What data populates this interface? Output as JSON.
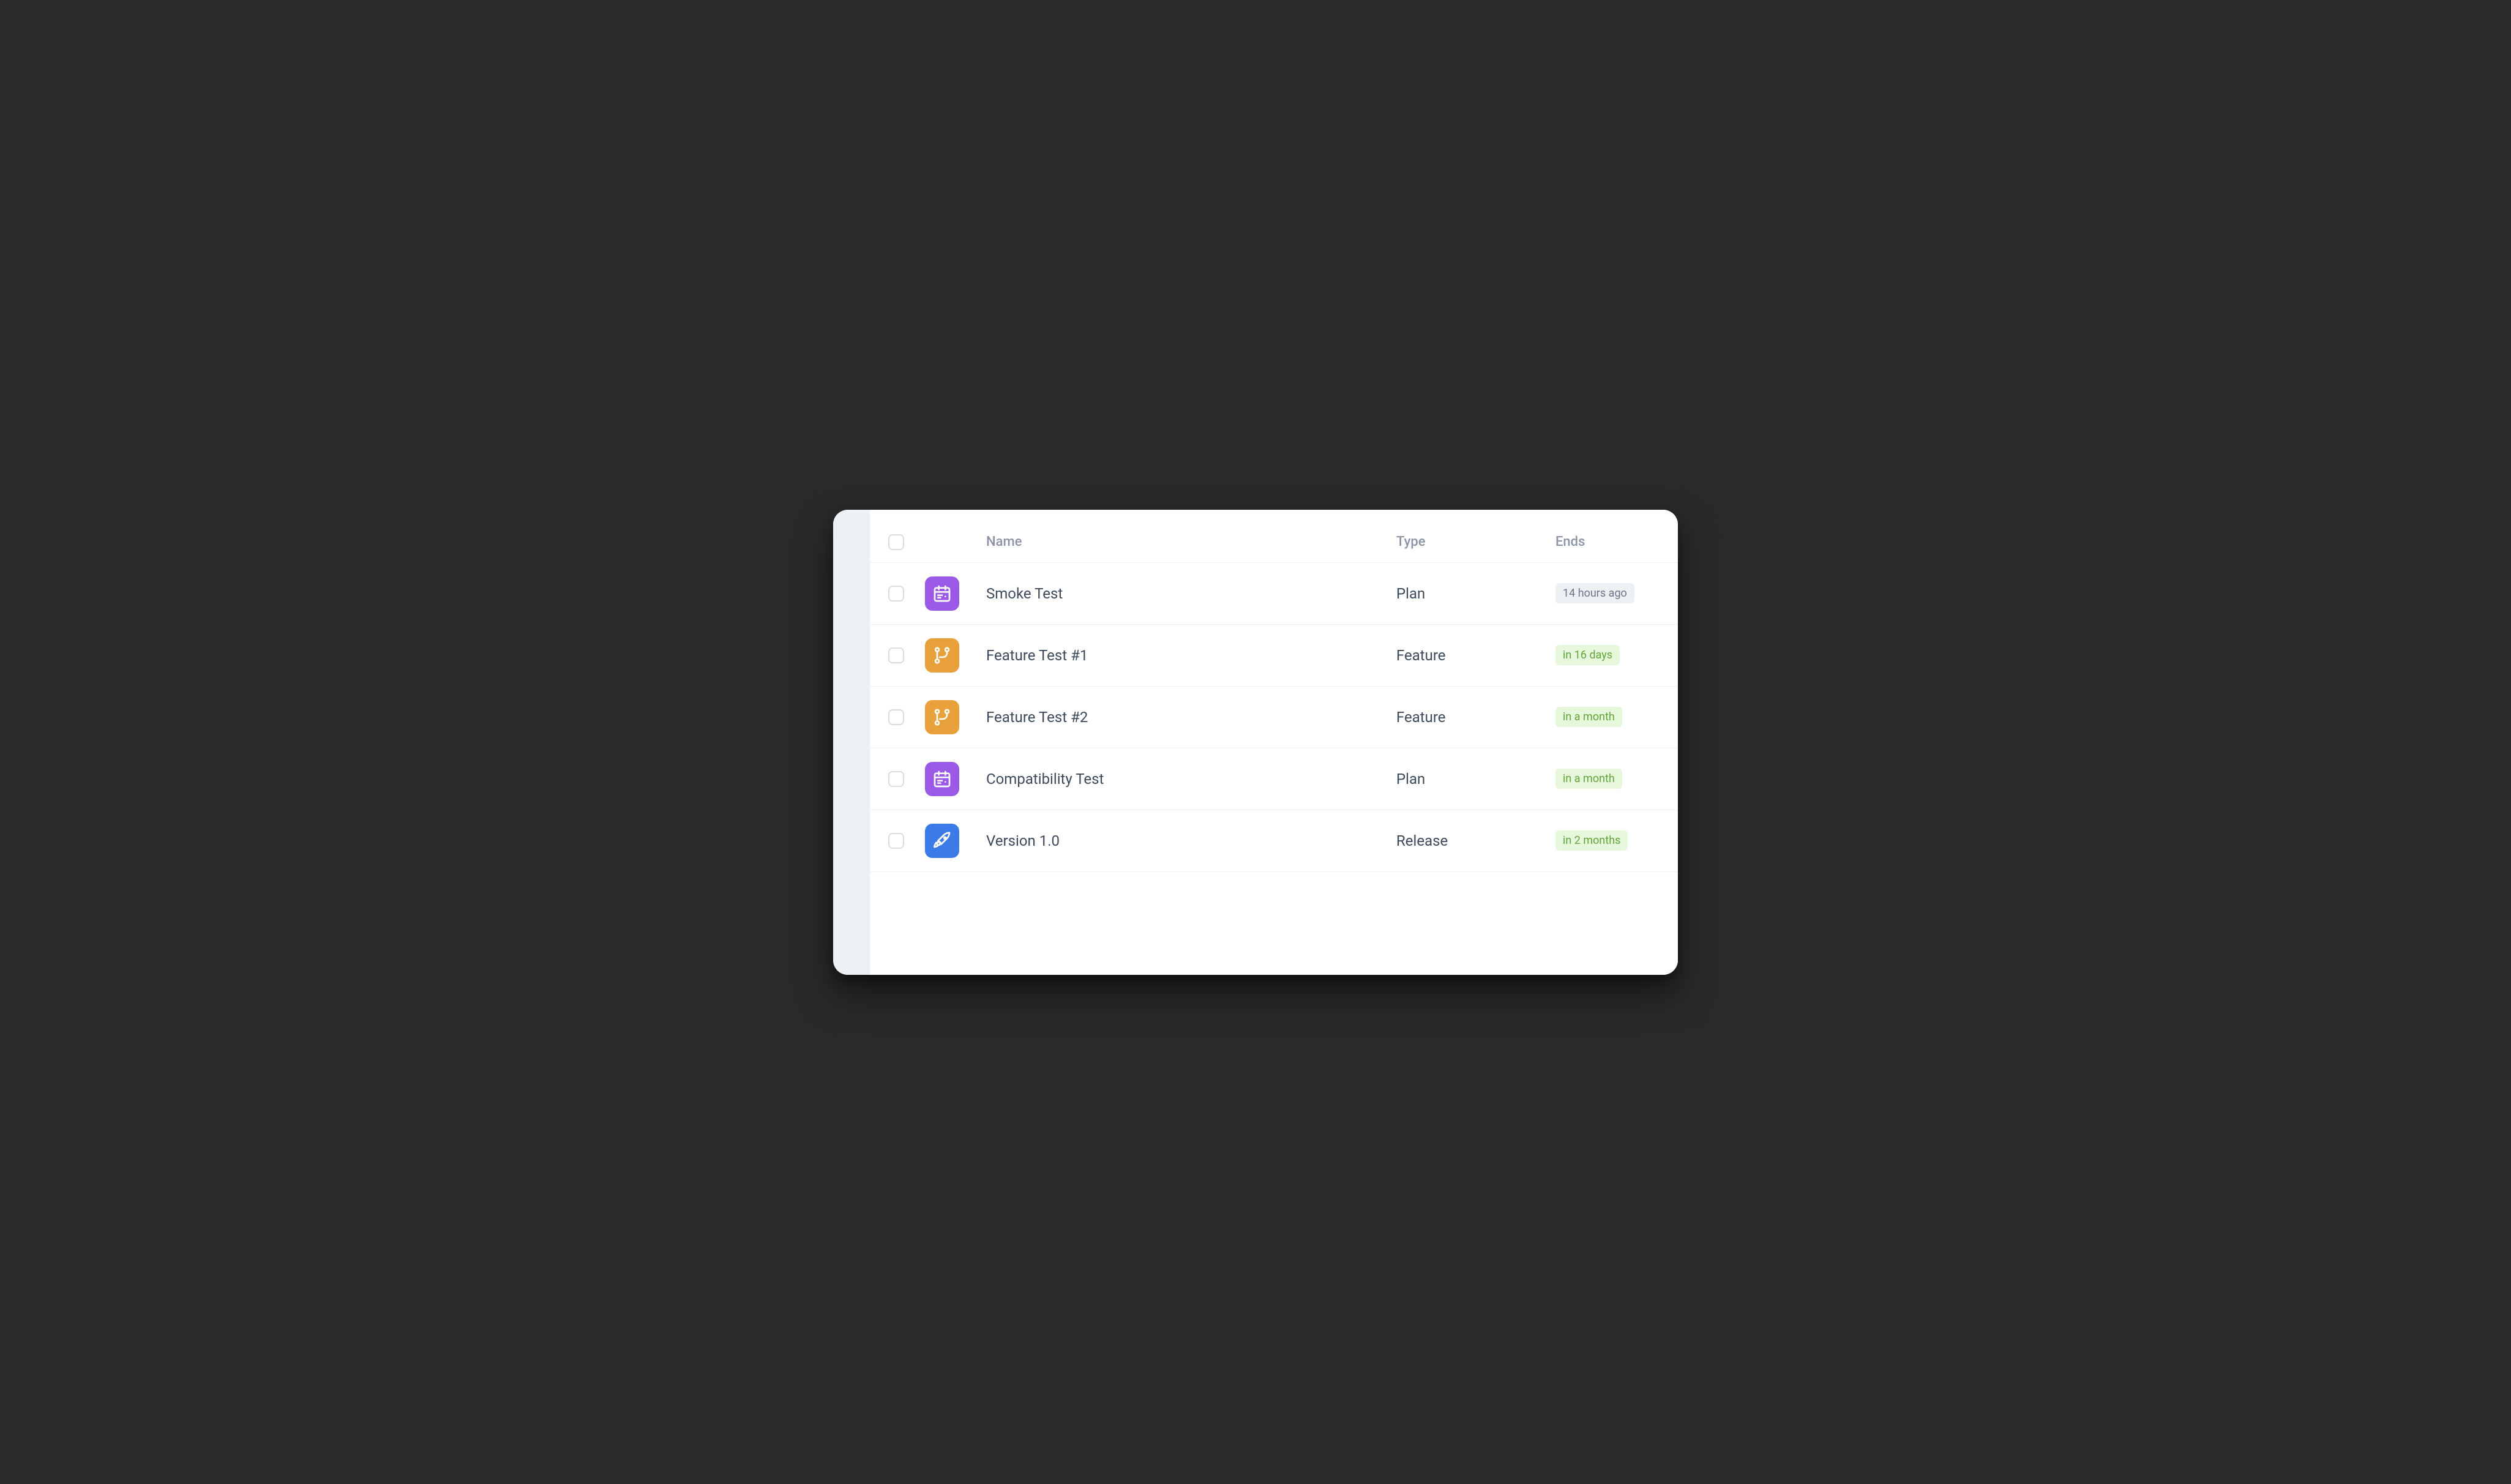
{
  "columns": {
    "name": "Name",
    "type": "Type",
    "ends": "Ends"
  },
  "icon_colors": {
    "Plan": "icon-purple",
    "Feature": "icon-orange",
    "Release": "icon-blue"
  },
  "icon_names": {
    "Plan": "calendar-icon",
    "Feature": "branch-icon",
    "Release": "rocket-icon"
  },
  "rows": [
    {
      "name": "Smoke Test",
      "type": "Plan",
      "ends": "14 hours ago",
      "ends_style": "badge-gray"
    },
    {
      "name": "Feature Test #1",
      "type": "Feature",
      "ends": "in 16 days",
      "ends_style": "badge-green"
    },
    {
      "name": "Feature Test #2",
      "type": "Feature",
      "ends": "in a month",
      "ends_style": "badge-green"
    },
    {
      "name": "Compatibility Test",
      "type": "Plan",
      "ends": "in a month",
      "ends_style": "badge-green"
    },
    {
      "name": "Version 1.0",
      "type": "Release",
      "ends": "in 2 months",
      "ends_style": "badge-green"
    }
  ]
}
